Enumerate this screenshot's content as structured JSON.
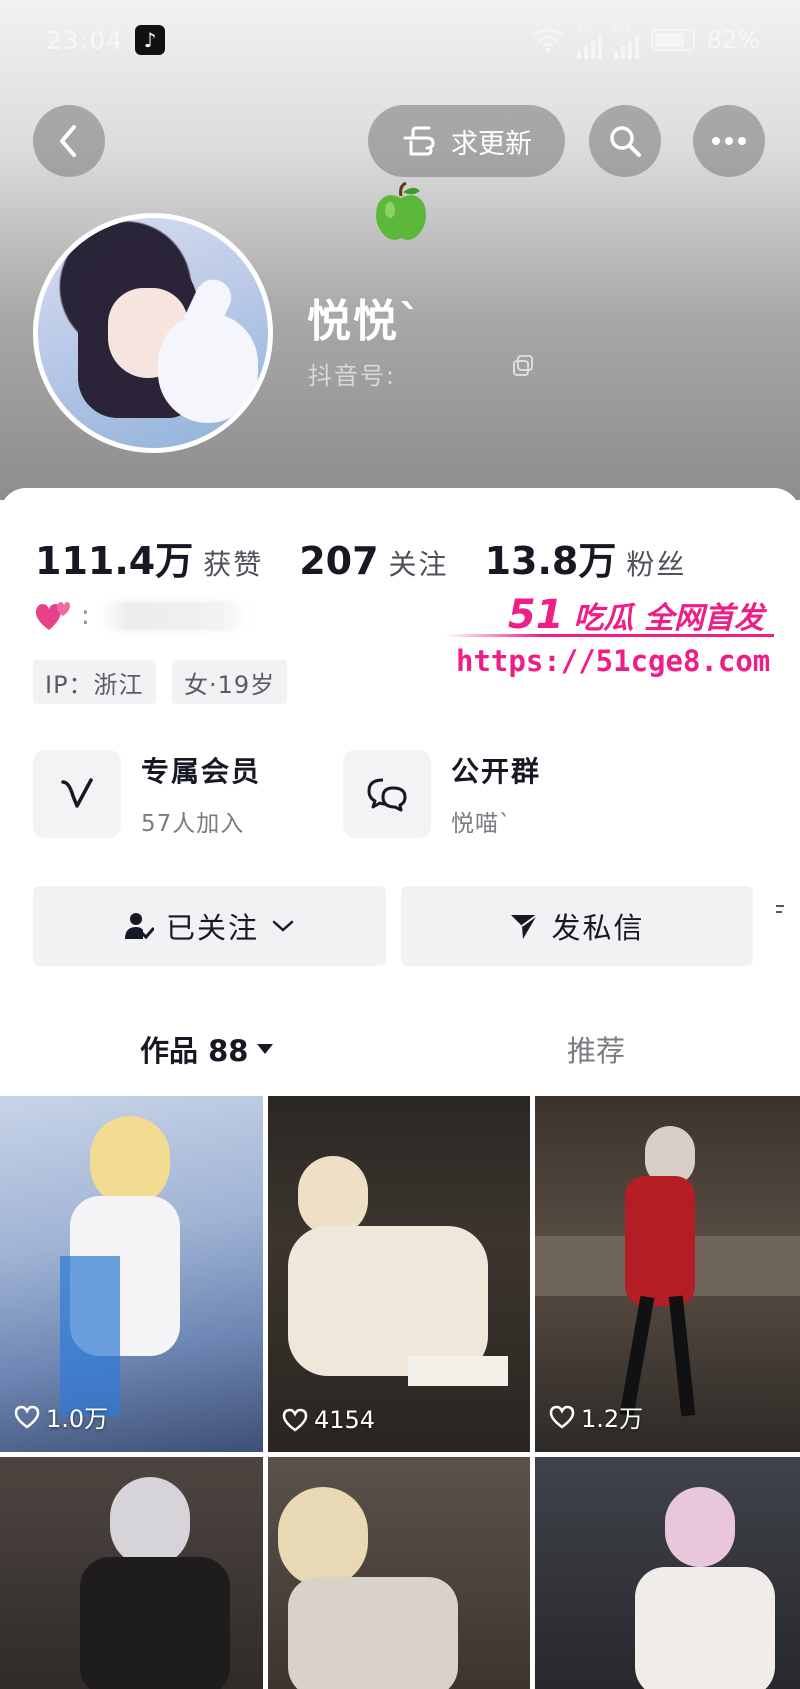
{
  "status_bar": {
    "time": "23:04",
    "tiktok_badge": "♪",
    "network_1": "5G",
    "network_2": "5G",
    "battery_pct": "82%",
    "battery_level": 0.82
  },
  "header": {
    "back_icon": "chevron-left-icon",
    "update_button_label": "求更新",
    "search_icon": "search-icon",
    "more_icon": "more-horizontal-icon"
  },
  "profile": {
    "nickname": "悦悦`",
    "douyin_id_label": "抖音号:",
    "stats": [
      {
        "value": "111.4万",
        "label": "获赞"
      },
      {
        "value": "207",
        "label": "关注"
      },
      {
        "value": "13.8万",
        "label": "粉丝"
      }
    ],
    "bio_icon": "💕",
    "bio_sep": ":",
    "tags": [
      "IP：浙江",
      "女·19岁"
    ]
  },
  "watermark": {
    "brand_num": "51",
    "brand_text": "吃瓜 全网首发",
    "url": "https://51cge8.com"
  },
  "features": [
    {
      "title": "专属会员",
      "subtitle": "57人加入",
      "icon": "v-icon"
    },
    {
      "title": "公开群",
      "subtitle": "悦喵`",
      "icon": "group-chat-icon"
    }
  ],
  "actions": {
    "follow_label": "已关注",
    "message_label": "发私信"
  },
  "tabs": {
    "works_label": "作品 88",
    "recommend_label": "推荐"
  },
  "videos": [
    {
      "likes": "1.0万"
    },
    {
      "likes": "4154"
    },
    {
      "likes": "1.2万"
    },
    {
      "likes": ""
    },
    {
      "likes": ""
    },
    {
      "likes": ""
    }
  ],
  "colors": {
    "accent_watermark": "#ee1e86",
    "text_primary": "#161823",
    "chip_bg": "#f2f2f4"
  }
}
